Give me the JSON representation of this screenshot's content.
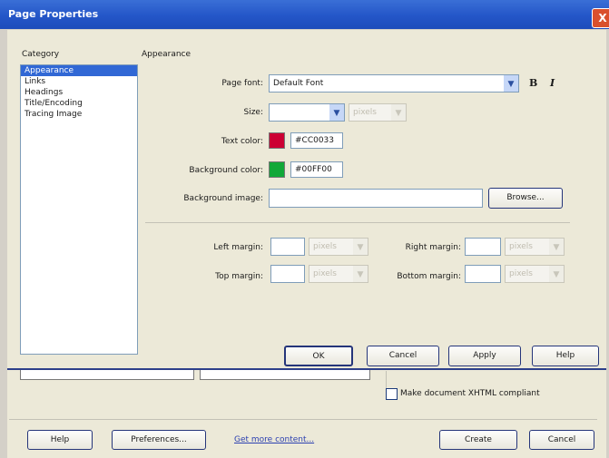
{
  "window": {
    "title": "Page Properties",
    "close_glyph": "X"
  },
  "category": {
    "header": "Category",
    "items": [
      "Appearance",
      "Links",
      "Headings",
      "Title/Encoding",
      "Tracing Image"
    ],
    "selected": "Appearance"
  },
  "panel": {
    "header": "Appearance",
    "page_font": {
      "label": "Page font:",
      "value": "Default Font",
      "bold": "B",
      "italic": "I"
    },
    "size": {
      "label": "Size:",
      "value": "",
      "unit": "pixels"
    },
    "text_color": {
      "label": "Text color:",
      "value": "#CC0033",
      "swatch": "#cc0033"
    },
    "background_color": {
      "label": "Background color:",
      "value": "#00FF00",
      "swatch": "#11a838"
    },
    "background_image": {
      "label": "Background image:",
      "value": "",
      "browse": "Browse..."
    },
    "margins": {
      "left": {
        "label": "Left margin:",
        "unit": "pixels"
      },
      "right": {
        "label": "Right margin:",
        "unit": "pixels"
      },
      "top": {
        "label": "Top margin:",
        "unit": "pixels"
      },
      "bottom": {
        "label": "Bottom margin:",
        "unit": "pixels"
      }
    }
  },
  "buttons": {
    "ok": "OK",
    "cancel": "Cancel",
    "apply": "Apply",
    "help": "Help"
  },
  "footer": {
    "xhtml_checkbox": {
      "label": "Make document XHTML compliant",
      "checked": false
    },
    "help": "Help",
    "preferences": "Preferences...",
    "more_content": "Get more content...",
    "create": "Create",
    "cancel": "Cancel"
  }
}
